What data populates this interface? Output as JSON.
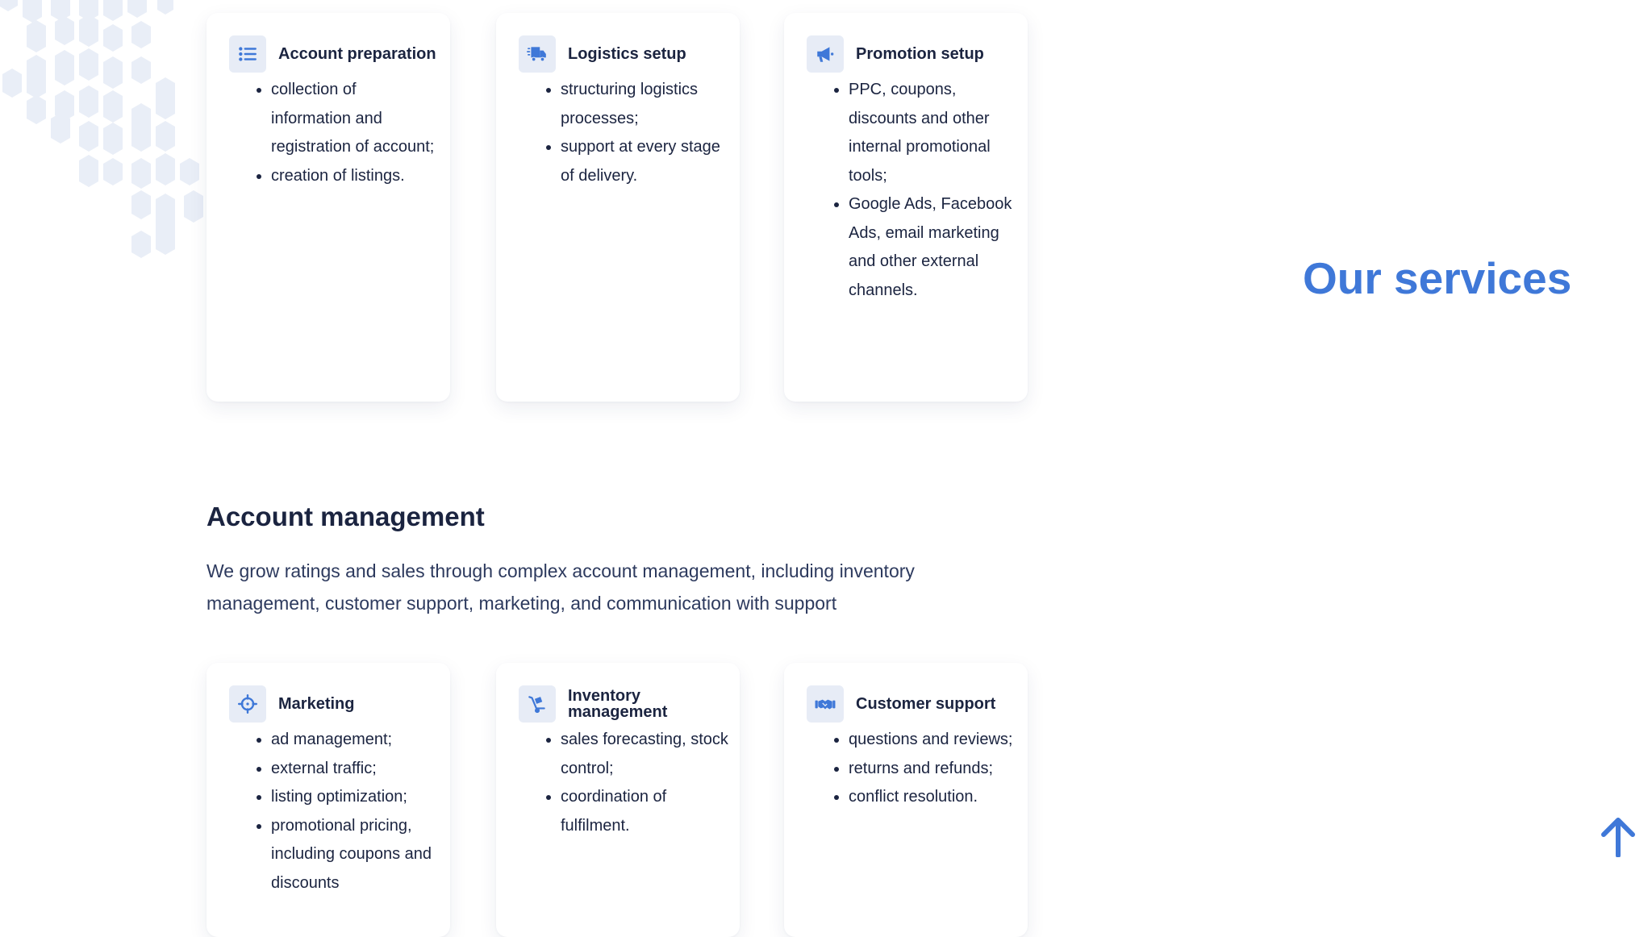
{
  "background_hexagons": "hexagon-pattern",
  "top_cards": [
    {
      "icon": "list-icon",
      "title": "Account preparation",
      "items": [
        "collection of information and registration of account;",
        "creation of listings."
      ]
    },
    {
      "icon": "truck-icon",
      "title": "Logistics setup",
      "items": [
        "structuring logistics processes;",
        "support at every stage of delivery."
      ]
    },
    {
      "icon": "megaphone-icon",
      "title": "Promotion setup",
      "items": [
        "PPC, coupons, discounts and other internal promotional tools;",
        "Google Ads, Facebook Ads, email marketing and other external channels."
      ]
    }
  ],
  "section": {
    "title": "Account management",
    "description": "We grow ratings and sales through complex account management, including inventory management, customer support, marketing, and communication with support"
  },
  "bottom_cards": [
    {
      "icon": "crosshair-icon",
      "title": "Marketing",
      "items": [
        "ad management;",
        "external traffic;",
        "listing optimization;",
        "promotional pricing, including coupons and discounts"
      ]
    },
    {
      "icon": "hand-cart-icon",
      "title": "Inventory management",
      "items": [
        "sales forecasting, stock control;",
        "coordination of fulfilment."
      ]
    },
    {
      "icon": "handshake-icon",
      "title": "Customer support",
      "items": [
        "questions and reviews;",
        "returns and refunds;",
        "conflict resolution."
      ]
    }
  ],
  "side_heading": "Our services",
  "scroll_top_icon": "arrow-up-icon",
  "colors": {
    "accent": "#3f78d8",
    "heading": "#1b2440",
    "body_text": "#2d3a5e",
    "icon_bg": "#e7ecf6",
    "hexagon": "#e9eef7"
  }
}
